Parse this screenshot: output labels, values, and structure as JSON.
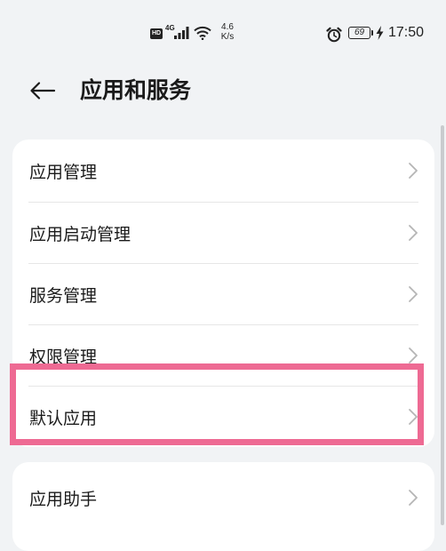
{
  "status_bar": {
    "hd": "HD",
    "network": "4G",
    "speed_value": "4.6",
    "speed_unit": "K/s",
    "battery": "69",
    "time": "17:50"
  },
  "header": {
    "back_icon": "arrow-left-icon",
    "title": "应用和服务"
  },
  "card_1": {
    "items": [
      {
        "label": "应用管理"
      },
      {
        "label": "应用启动管理"
      },
      {
        "label": "服务管理"
      },
      {
        "label": "权限管理"
      },
      {
        "label": "默认应用"
      }
    ]
  },
  "card_2": {
    "items": [
      {
        "label": "应用助手"
      }
    ]
  },
  "icons": {
    "chevron": "chevron-right-icon",
    "alarm": "alarm-clock-icon",
    "charging": "lightning-icon"
  },
  "colors": {
    "background": "#f1f3f5",
    "card": "#ffffff",
    "highlight": "#ee6a93"
  }
}
